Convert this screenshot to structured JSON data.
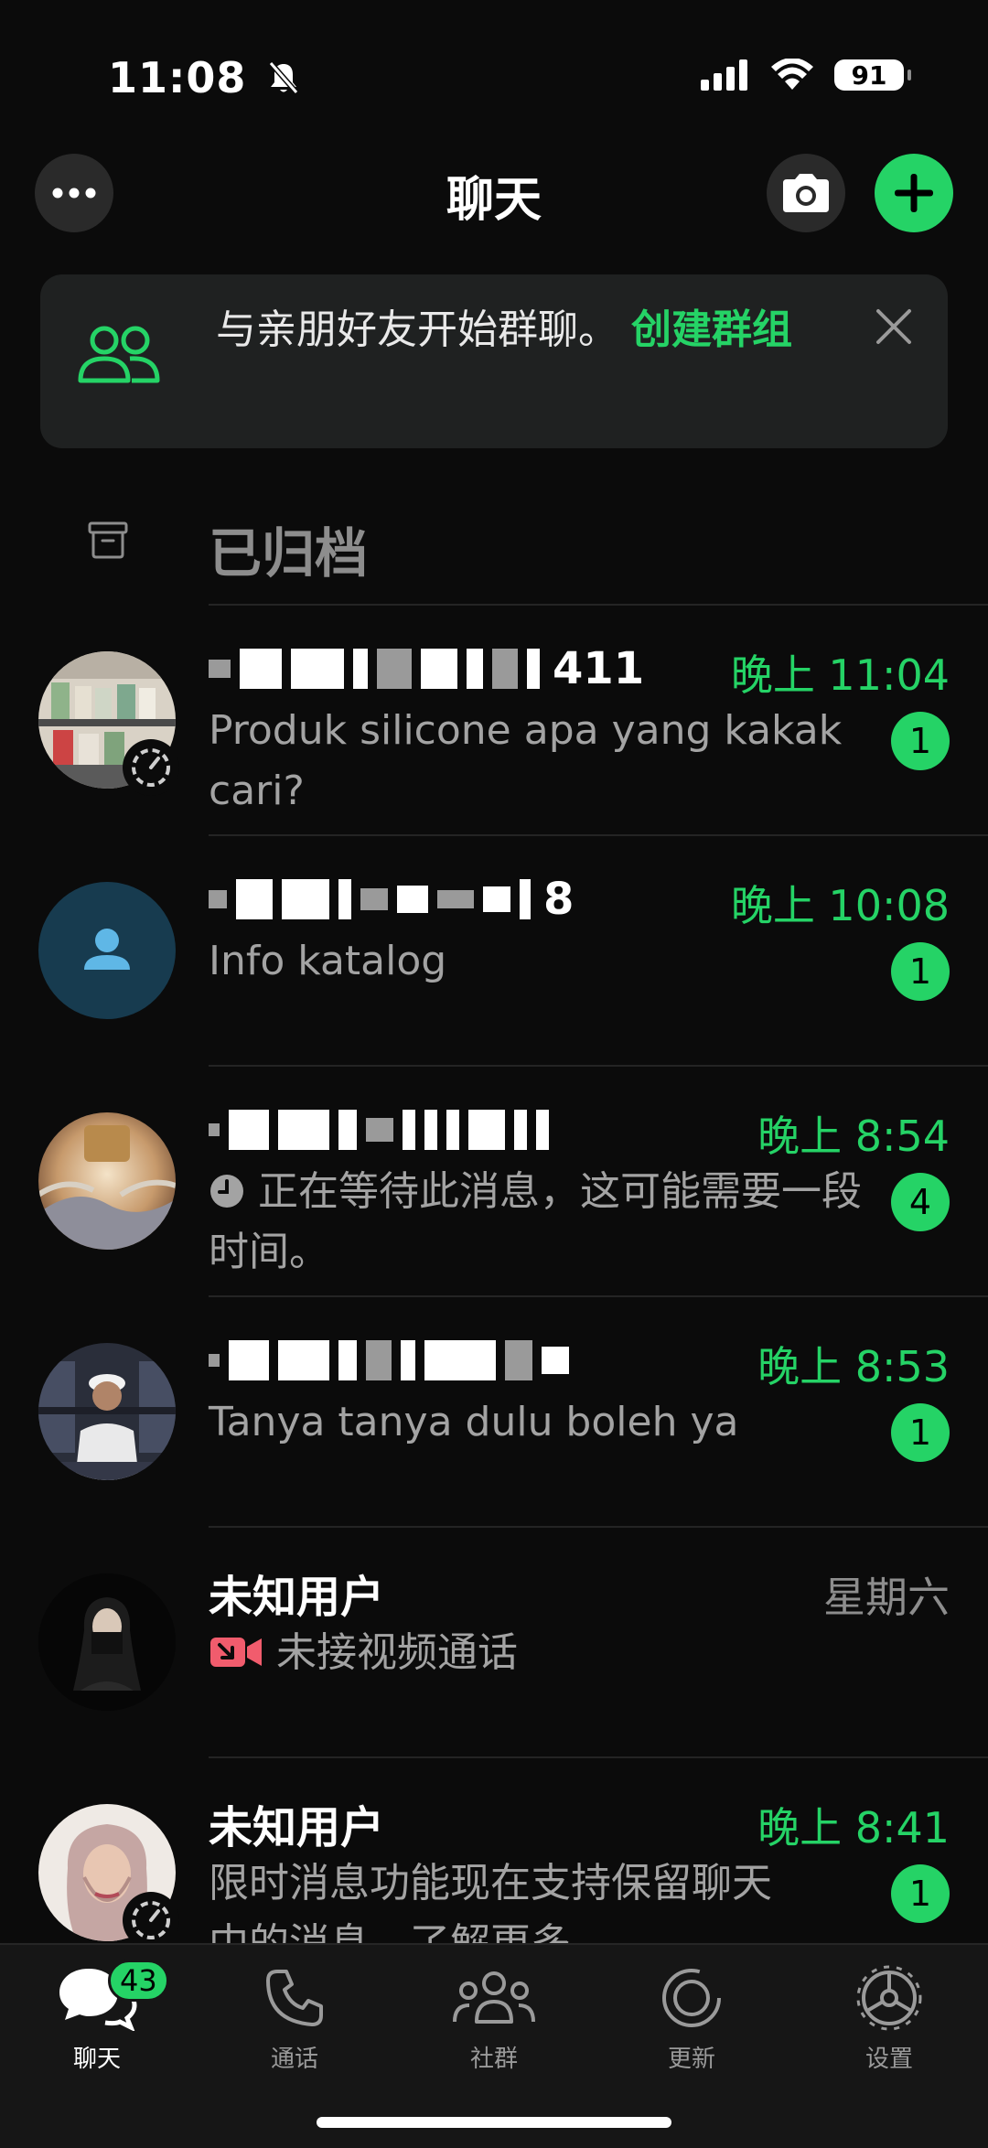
{
  "status_bar": {
    "time": "11:08",
    "battery": "91"
  },
  "header": {
    "title": "聊天"
  },
  "banner": {
    "text": "与亲朋好友开始群聊。",
    "link": "创建群组"
  },
  "archived": {
    "label": "已归档"
  },
  "chats": [
    {
      "name_suffix": "411",
      "time": "晚上 11:04",
      "preview": "Produk silicone apa yang kakak cari?",
      "unread": "1"
    },
    {
      "name_suffix": "8",
      "time": "晚上 10:08",
      "preview": "Info katalog",
      "unread": "1"
    },
    {
      "name_suffix": "",
      "time": "晚上 8:54",
      "preview": "正在等待此消息，这可能需要一段时间。",
      "unread": "4"
    },
    {
      "name_suffix": "",
      "time": "晚上 8:53",
      "preview": "Tanya tanya dulu boleh ya",
      "unread": "1"
    },
    {
      "name": "未知用户",
      "time": "星期六",
      "preview": "未接视频通话"
    },
    {
      "name": "未知用户",
      "time": "晚上 8:41",
      "preview": "限时消息功能现在支持保留聊天中的消息。了解更多",
      "unread": "1"
    }
  ],
  "tabs": [
    {
      "label": "聊天",
      "icon": "chats-icon",
      "badge": "43"
    },
    {
      "label": "通话",
      "icon": "phone-icon"
    },
    {
      "label": "社群",
      "icon": "communities-icon"
    },
    {
      "label": "更新",
      "icon": "updates-icon"
    },
    {
      "label": "设置",
      "icon": "settings-icon"
    }
  ],
  "colors": {
    "accent": "#25d366",
    "background": "#0b0b0b",
    "missed_call": "#f15c6d"
  }
}
